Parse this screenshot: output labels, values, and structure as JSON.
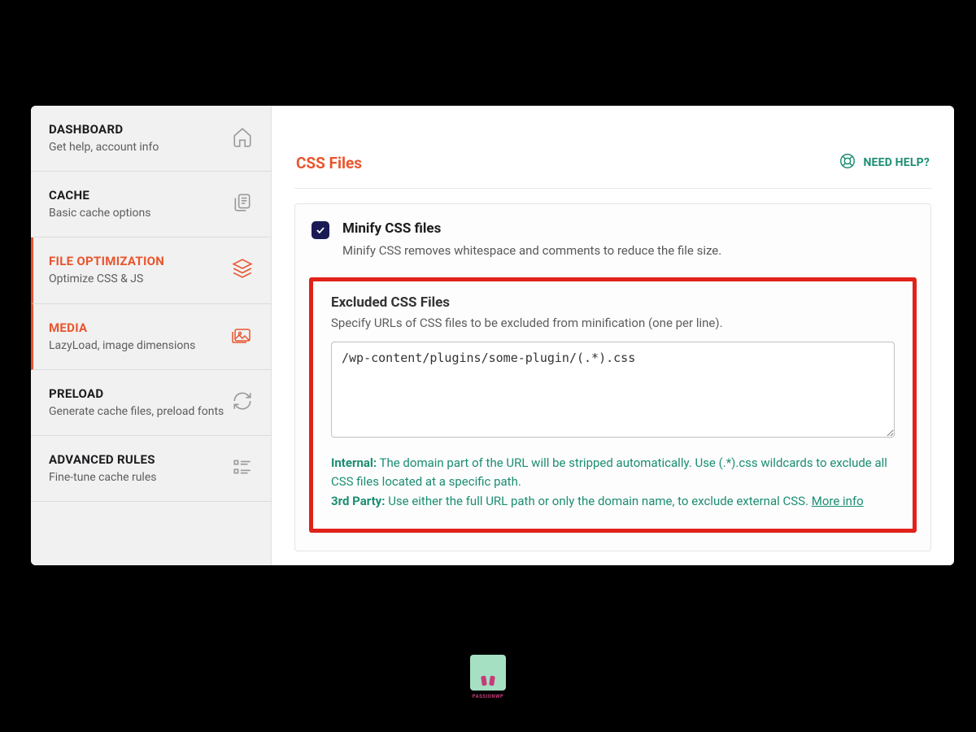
{
  "sidebar": {
    "items": [
      {
        "title": "DASHBOARD",
        "sub": "Get help, account info",
        "icon": "home"
      },
      {
        "title": "CACHE",
        "sub": "Basic cache options",
        "icon": "copy"
      },
      {
        "title": "FILE OPTIMIZATION",
        "sub": "Optimize CSS & JS",
        "icon": "layers"
      },
      {
        "title": "MEDIA",
        "sub": "LazyLoad, image dimensions",
        "icon": "images"
      },
      {
        "title": "PRELOAD",
        "sub": "Generate cache files, preload fonts",
        "icon": "refresh"
      },
      {
        "title": "ADVANCED RULES",
        "sub": "Fine-tune cache rules",
        "icon": "list"
      }
    ]
  },
  "main": {
    "title": "CSS Files",
    "help_label": "NEED HELP?",
    "option": {
      "title": "Minify CSS files",
      "desc": "Minify CSS removes whitespace and comments to reduce the file size."
    },
    "excluded": {
      "title": "Excluded CSS Files",
      "desc": "Specify URLs of CSS files to be excluded from minification (one per line).",
      "value": "/wp-content/plugins/some-plugin/(.*).css",
      "note_internal_label": "Internal:",
      "note_internal_text": " The domain part of the URL will be stripped automatically. Use (.*).css wildcards to exclude all CSS files located at a specific path.",
      "note_3rd_label": "3rd Party:",
      "note_3rd_text": " Use either the full URL path or only the domain name, to exclude external CSS. ",
      "more_info": "More info"
    }
  },
  "footer_logo_text": "PASSIONWP"
}
